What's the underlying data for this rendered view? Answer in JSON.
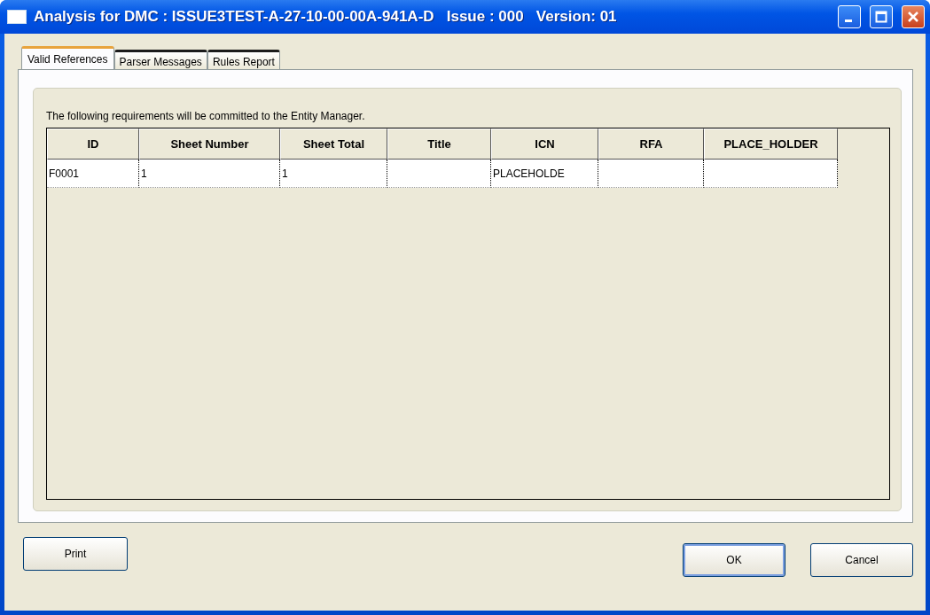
{
  "window": {
    "title": "Analysis for DMC : ISSUE3TEST-A-27-10-00-00A-941A-D   Issue : 000   Version: 01"
  },
  "tabs": [
    {
      "label": "Valid References",
      "selected": true
    },
    {
      "label": "Parser Messages",
      "selected": false
    },
    {
      "label": "Rules Report",
      "selected": false
    }
  ],
  "message": "The following requirements will be committed to the Entity Manager.",
  "table": {
    "columns": [
      "ID",
      "Sheet Number",
      "Sheet Total",
      "Title",
      "ICN",
      "RFA",
      "PLACE_HOLDER"
    ],
    "rows": [
      [
        "F0001",
        "1",
        "1",
        "",
        "PLACEHOLDE",
        "",
        ""
      ]
    ]
  },
  "buttons": {
    "left": [
      "Print"
    ],
    "right": [
      {
        "label": "OK",
        "default": true
      },
      {
        "label": "Cancel",
        "default": false
      }
    ]
  }
}
